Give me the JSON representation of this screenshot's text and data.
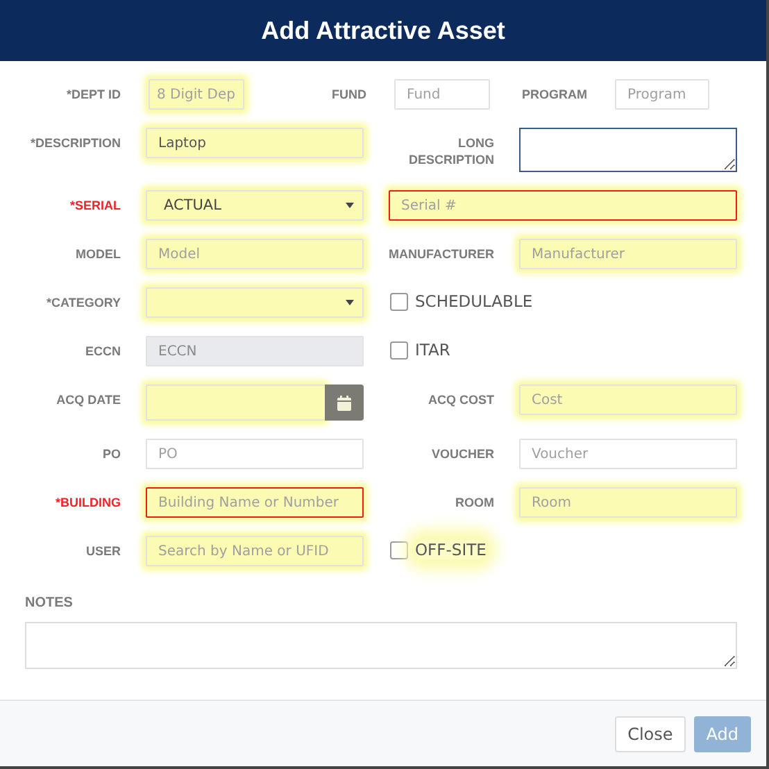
{
  "window": {
    "title": "Add Attractive Asset"
  },
  "rows": [
    {
      "items": [
        {
          "label": "*DEPT ID",
          "error": false,
          "field": {
            "kind": "text",
            "placeholder": "8 Digit Dep",
            "highlighted": true
          }
        },
        {
          "label": "FUND",
          "error": false,
          "field": {
            "kind": "text",
            "placeholder": "Fund",
            "highlighted": false
          }
        },
        {
          "label": "PROGRAM",
          "error": false,
          "field": {
            "kind": "text",
            "placeholder": "Program",
            "highlighted": false
          }
        }
      ]
    },
    {
      "items": [
        {
          "label": "*DESCRIPTION",
          "error": false,
          "field": {
            "kind": "text",
            "value": "Laptop",
            "highlighted": true
          }
        },
        {
          "label": "LONG DESCRIPTION",
          "error": false,
          "field": {
            "kind": "textarea",
            "focused": true,
            "highlighted": false
          }
        }
      ]
    },
    {
      "items": [
        {
          "label": "*SERIAL",
          "error": true,
          "field": {
            "kind": "select",
            "value": "ACTUAL",
            "highlighted": true
          }
        },
        {
          "field": {
            "kind": "text",
            "placeholder": "Serial #",
            "invalid": true,
            "highlighted": true
          }
        }
      ]
    },
    {
      "items": [
        {
          "label": "MODEL",
          "error": false,
          "field": {
            "kind": "text",
            "placeholder": "Model",
            "highlighted": true
          }
        },
        {
          "label": "MANUFACTURER",
          "error": false,
          "field": {
            "kind": "text",
            "placeholder": "Manufacturer",
            "highlighted": true
          }
        }
      ]
    },
    {
      "items": [
        {
          "label": "*CATEGORY",
          "error": false,
          "field": {
            "kind": "select",
            "highlighted": true
          }
        },
        {
          "field": {
            "kind": "checkbox",
            "label": "SCHEDULABLE",
            "checked": false,
            "highlighted": false
          }
        }
      ]
    },
    {
      "items": [
        {
          "label": "ECCN",
          "error": false,
          "field": {
            "kind": "text",
            "placeholder": "ECCN",
            "disabled": true,
            "highlighted": false
          }
        },
        {
          "field": {
            "kind": "checkbox",
            "label": "ITAR",
            "checked": false,
            "highlighted": false
          }
        }
      ]
    },
    {
      "items": [
        {
          "label": "ACQ DATE",
          "error": false,
          "field": {
            "kind": "date",
            "highlighted": true
          }
        },
        {
          "label": "ACQ COST",
          "error": false,
          "field": {
            "kind": "text",
            "placeholder": "Cost",
            "highlighted": true
          }
        }
      ]
    },
    {
      "items": [
        {
          "label": "PO",
          "error": false,
          "field": {
            "kind": "text",
            "placeholder": "PO",
            "highlighted": false
          }
        },
        {
          "label": "VOUCHER",
          "error": false,
          "field": {
            "kind": "text",
            "placeholder": "Voucher",
            "highlighted": false
          }
        }
      ]
    },
    {
      "items": [
        {
          "label": "*BUILDING",
          "error": true,
          "field": {
            "kind": "text",
            "placeholder": "Building Name or Number",
            "invalid": true,
            "highlighted": true
          }
        },
        {
          "label": "ROOM",
          "error": false,
          "field": {
            "kind": "text",
            "placeholder": "Room",
            "highlighted": true
          }
        }
      ]
    },
    {
      "items": [
        {
          "label": "USER",
          "error": false,
          "field": {
            "kind": "text",
            "placeholder": "Search by Name or UFID",
            "highlighted": true
          }
        },
        {
          "field": {
            "kind": "checkbox",
            "label": "OFF-SITE",
            "checked": false,
            "highlighted": true
          }
        }
      ]
    }
  ],
  "notes": {
    "label": "NOTES"
  },
  "buttons": [
    {
      "label": "Close",
      "kind": "secondary",
      "disabled": false
    },
    {
      "label": "Add",
      "kind": "primary",
      "disabled": true
    }
  ]
}
